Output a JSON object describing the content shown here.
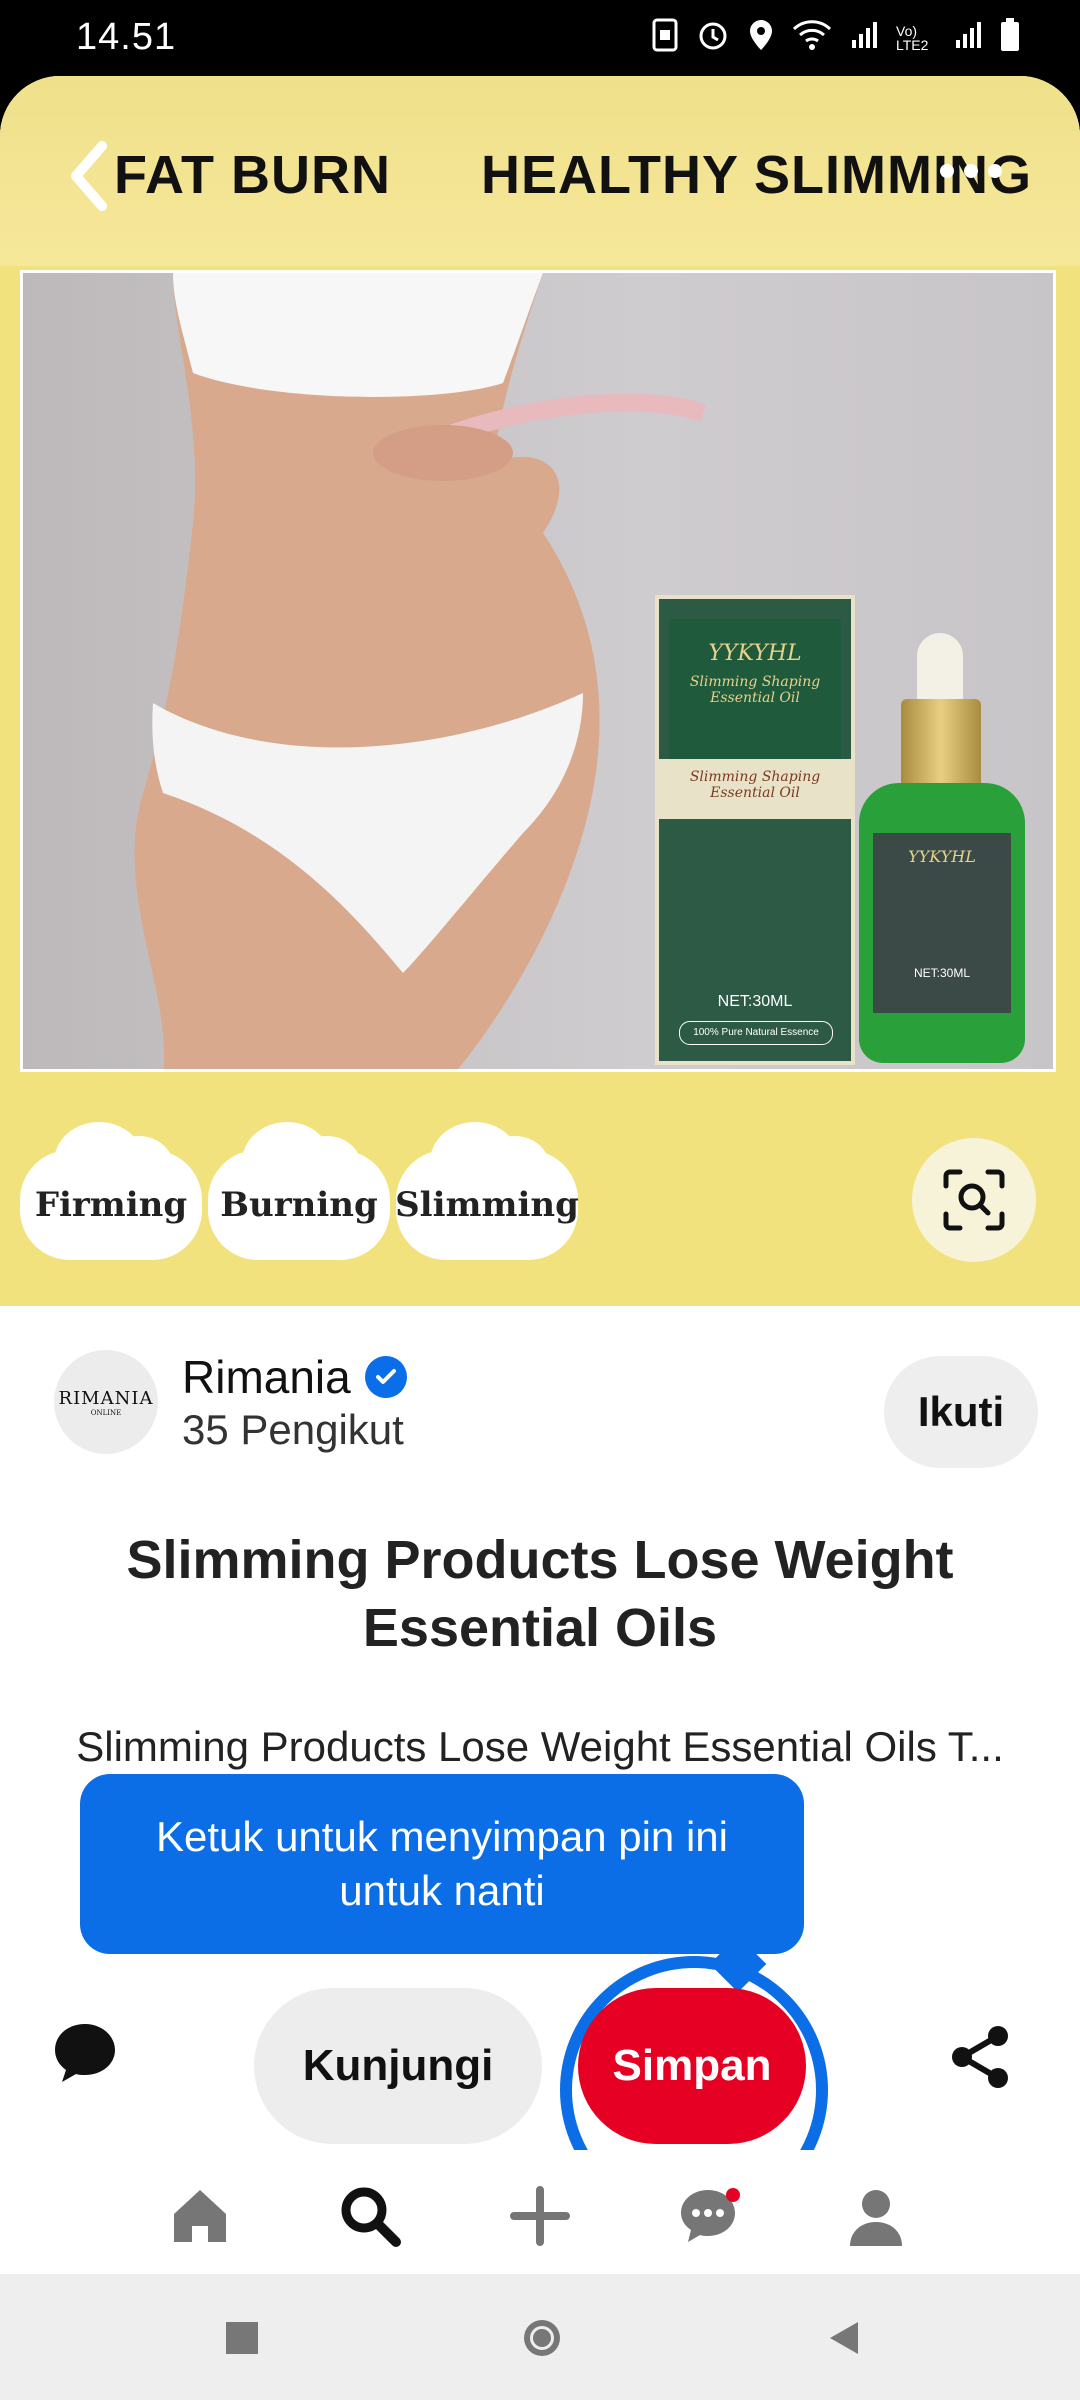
{
  "status_bar": {
    "time": "14.51",
    "network_label": "Vo) LTE2"
  },
  "hero": {
    "left_text": "FAT BURN",
    "right_text": "HEALTHY SLIMMING",
    "tags": [
      "Firming",
      "Burning",
      "Slimming"
    ],
    "product": {
      "brand": "YYKYHL",
      "name": "Slimming Shaping Essential Oil",
      "net": "NET:30ML",
      "badge": "100% Pure Natural Essence"
    }
  },
  "creator": {
    "avatar_text": "RIMANIA",
    "avatar_sub": "ONLINE",
    "name": "Rimania",
    "followers": "35 Pengikut",
    "follow_label": "Ikuti"
  },
  "pin": {
    "title": "Slimming Products Lose Weight Essential Oils",
    "description_visible": "Slimming Products Lose Weight Essential Oils T... nti Cellulite ...bottles a"
  },
  "tooltip": {
    "text": "Ketuk untuk menyimpan pin ini untuk nanti"
  },
  "actions": {
    "visit_label": "Kunjungi",
    "save_label": "Simpan"
  },
  "colors": {
    "save_red": "#e60023",
    "highlight_blue": "#0b6ee6",
    "hero_yellow": "#f2e27d"
  }
}
